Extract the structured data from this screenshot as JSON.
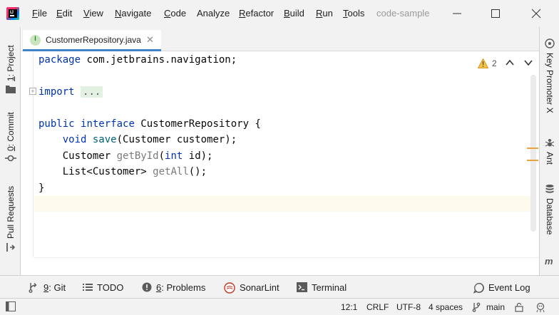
{
  "menubar": {
    "items": [
      {
        "label": "File",
        "mnemonic": "F",
        "rest": "ile"
      },
      {
        "label": "Edit",
        "mnemonic": "E",
        "rest": "dit"
      },
      {
        "label": "View",
        "mnemonic": "V",
        "rest": "iew"
      },
      {
        "label": "Navigate",
        "mnemonic": "N",
        "rest": "avigate"
      },
      {
        "label": "Code",
        "mnemonic": "C",
        "rest": "ode"
      },
      {
        "label": "Analyze",
        "mnemonic": "",
        "rest": "Analyze"
      },
      {
        "label": "Refactor",
        "mnemonic": "R",
        "rest": "efactor"
      },
      {
        "label": "Build",
        "mnemonic": "B",
        "rest": "uild"
      },
      {
        "label": "Run",
        "mnemonic": "R",
        "rest": "un"
      },
      {
        "label": "Tools",
        "mnemonic": "T",
        "rest": "ools"
      }
    ],
    "project_title": "code-sample"
  },
  "left_tools": {
    "project": {
      "number": "1",
      "label": ": Project"
    },
    "commit": {
      "number": "0",
      "label": ": Commit"
    },
    "pull_requests": {
      "label": "Pull Requests"
    }
  },
  "right_tools": {
    "key_promoter": "Key Promoter X",
    "ant": "Ant",
    "database": "Database"
  },
  "editor": {
    "tab_label": "CustomerRepository.java",
    "tab_icon_letter": "I",
    "warning_count": "2",
    "code": {
      "line1": {
        "kw": "package",
        "rest": " com.jetbrains.navigation;"
      },
      "line3": {
        "kw": "import",
        "folded": "..."
      },
      "line5": {
        "kw1": "public",
        "kw2": "interface",
        "name": " CustomerRepository {"
      },
      "line6": {
        "kw": "void",
        "fn": "save",
        "rest": "(Customer customer);"
      },
      "line7": {
        "type": "Customer",
        "fn": "getById",
        "kw": "int",
        "rest": " id);"
      },
      "line8": {
        "type": "List<Customer>",
        "fn": "getAll",
        "rest": "();"
      },
      "line9": "}"
    }
  },
  "bottom_tools": {
    "git": {
      "number": "9",
      "label": ": Git"
    },
    "todo": "TODO",
    "problems": {
      "number": "6",
      "label": ": Problems"
    },
    "sonarlint": "SonarLint",
    "terminal": "Terminal",
    "event_log": "Event Log"
  },
  "status": {
    "position": "12:1",
    "line_sep": "CRLF",
    "encoding": "UTF-8",
    "indent": "4 spaces",
    "branch": "main"
  },
  "colors": {
    "accent": "#4083c9",
    "warning": "#e8a33c",
    "keyword": "#0033b3",
    "method": "#00627a"
  }
}
